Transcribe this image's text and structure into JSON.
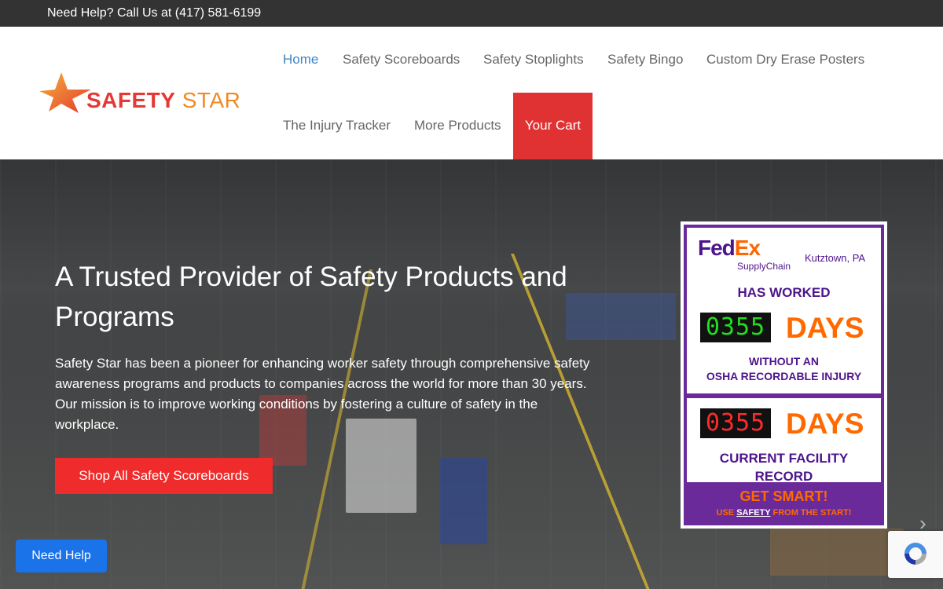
{
  "topbar": {
    "help_text": "Need Help? Call Us at (417) 581-6199"
  },
  "logo": {
    "word1": "SAFETY",
    "word2": "STAR",
    "icon": "star-icon"
  },
  "nav": {
    "items": [
      {
        "label": "Home",
        "active": true
      },
      {
        "label": "Safety Scoreboards"
      },
      {
        "label": "Safety Stoplights"
      },
      {
        "label": "Safety Bingo"
      },
      {
        "label": "Custom Dry Erase Posters"
      },
      {
        "label": "The Injury Tracker"
      },
      {
        "label": "More Products"
      }
    ],
    "cart_label": "Your Cart"
  },
  "hero": {
    "title": "A Trusted Provider of Safety Products and Programs",
    "text": "Safety Star has been a pioneer for enhancing worker safety through comprehensive safety awareness programs and products to companies across the world for more than 30 years. Our mission is to improve working conditions by fostering a culture of safety in the workplace.",
    "button_label": "Shop All Safety Scoreboards"
  },
  "sign": {
    "brand_fd": "Fed",
    "brand_ex": "Ex",
    "brand_sub": "SupplyChain",
    "city": "Kutztown, PA",
    "has_worked": "HAS WORKED",
    "counter1": "0355",
    "days1": "DAYS",
    "without1": "WITHOUT AN",
    "without2": "OSHA RECORDABLE INJURY",
    "counter2": "0355",
    "days2": "DAYS",
    "record1": "CURRENT FACILITY",
    "record2": "RECORD",
    "get_smart": "GET SMART!",
    "use_pre": "USE",
    "use_safety": "SAFETY",
    "use_post": "FROM THE START!"
  },
  "help_button": {
    "label": "Need Help"
  },
  "colors": {
    "accent_red": "#e03232",
    "link_blue": "#3a85c5",
    "help_blue": "#1a73e8",
    "fedex_purple": "#4d148c",
    "fedex_orange": "#ff6600"
  }
}
